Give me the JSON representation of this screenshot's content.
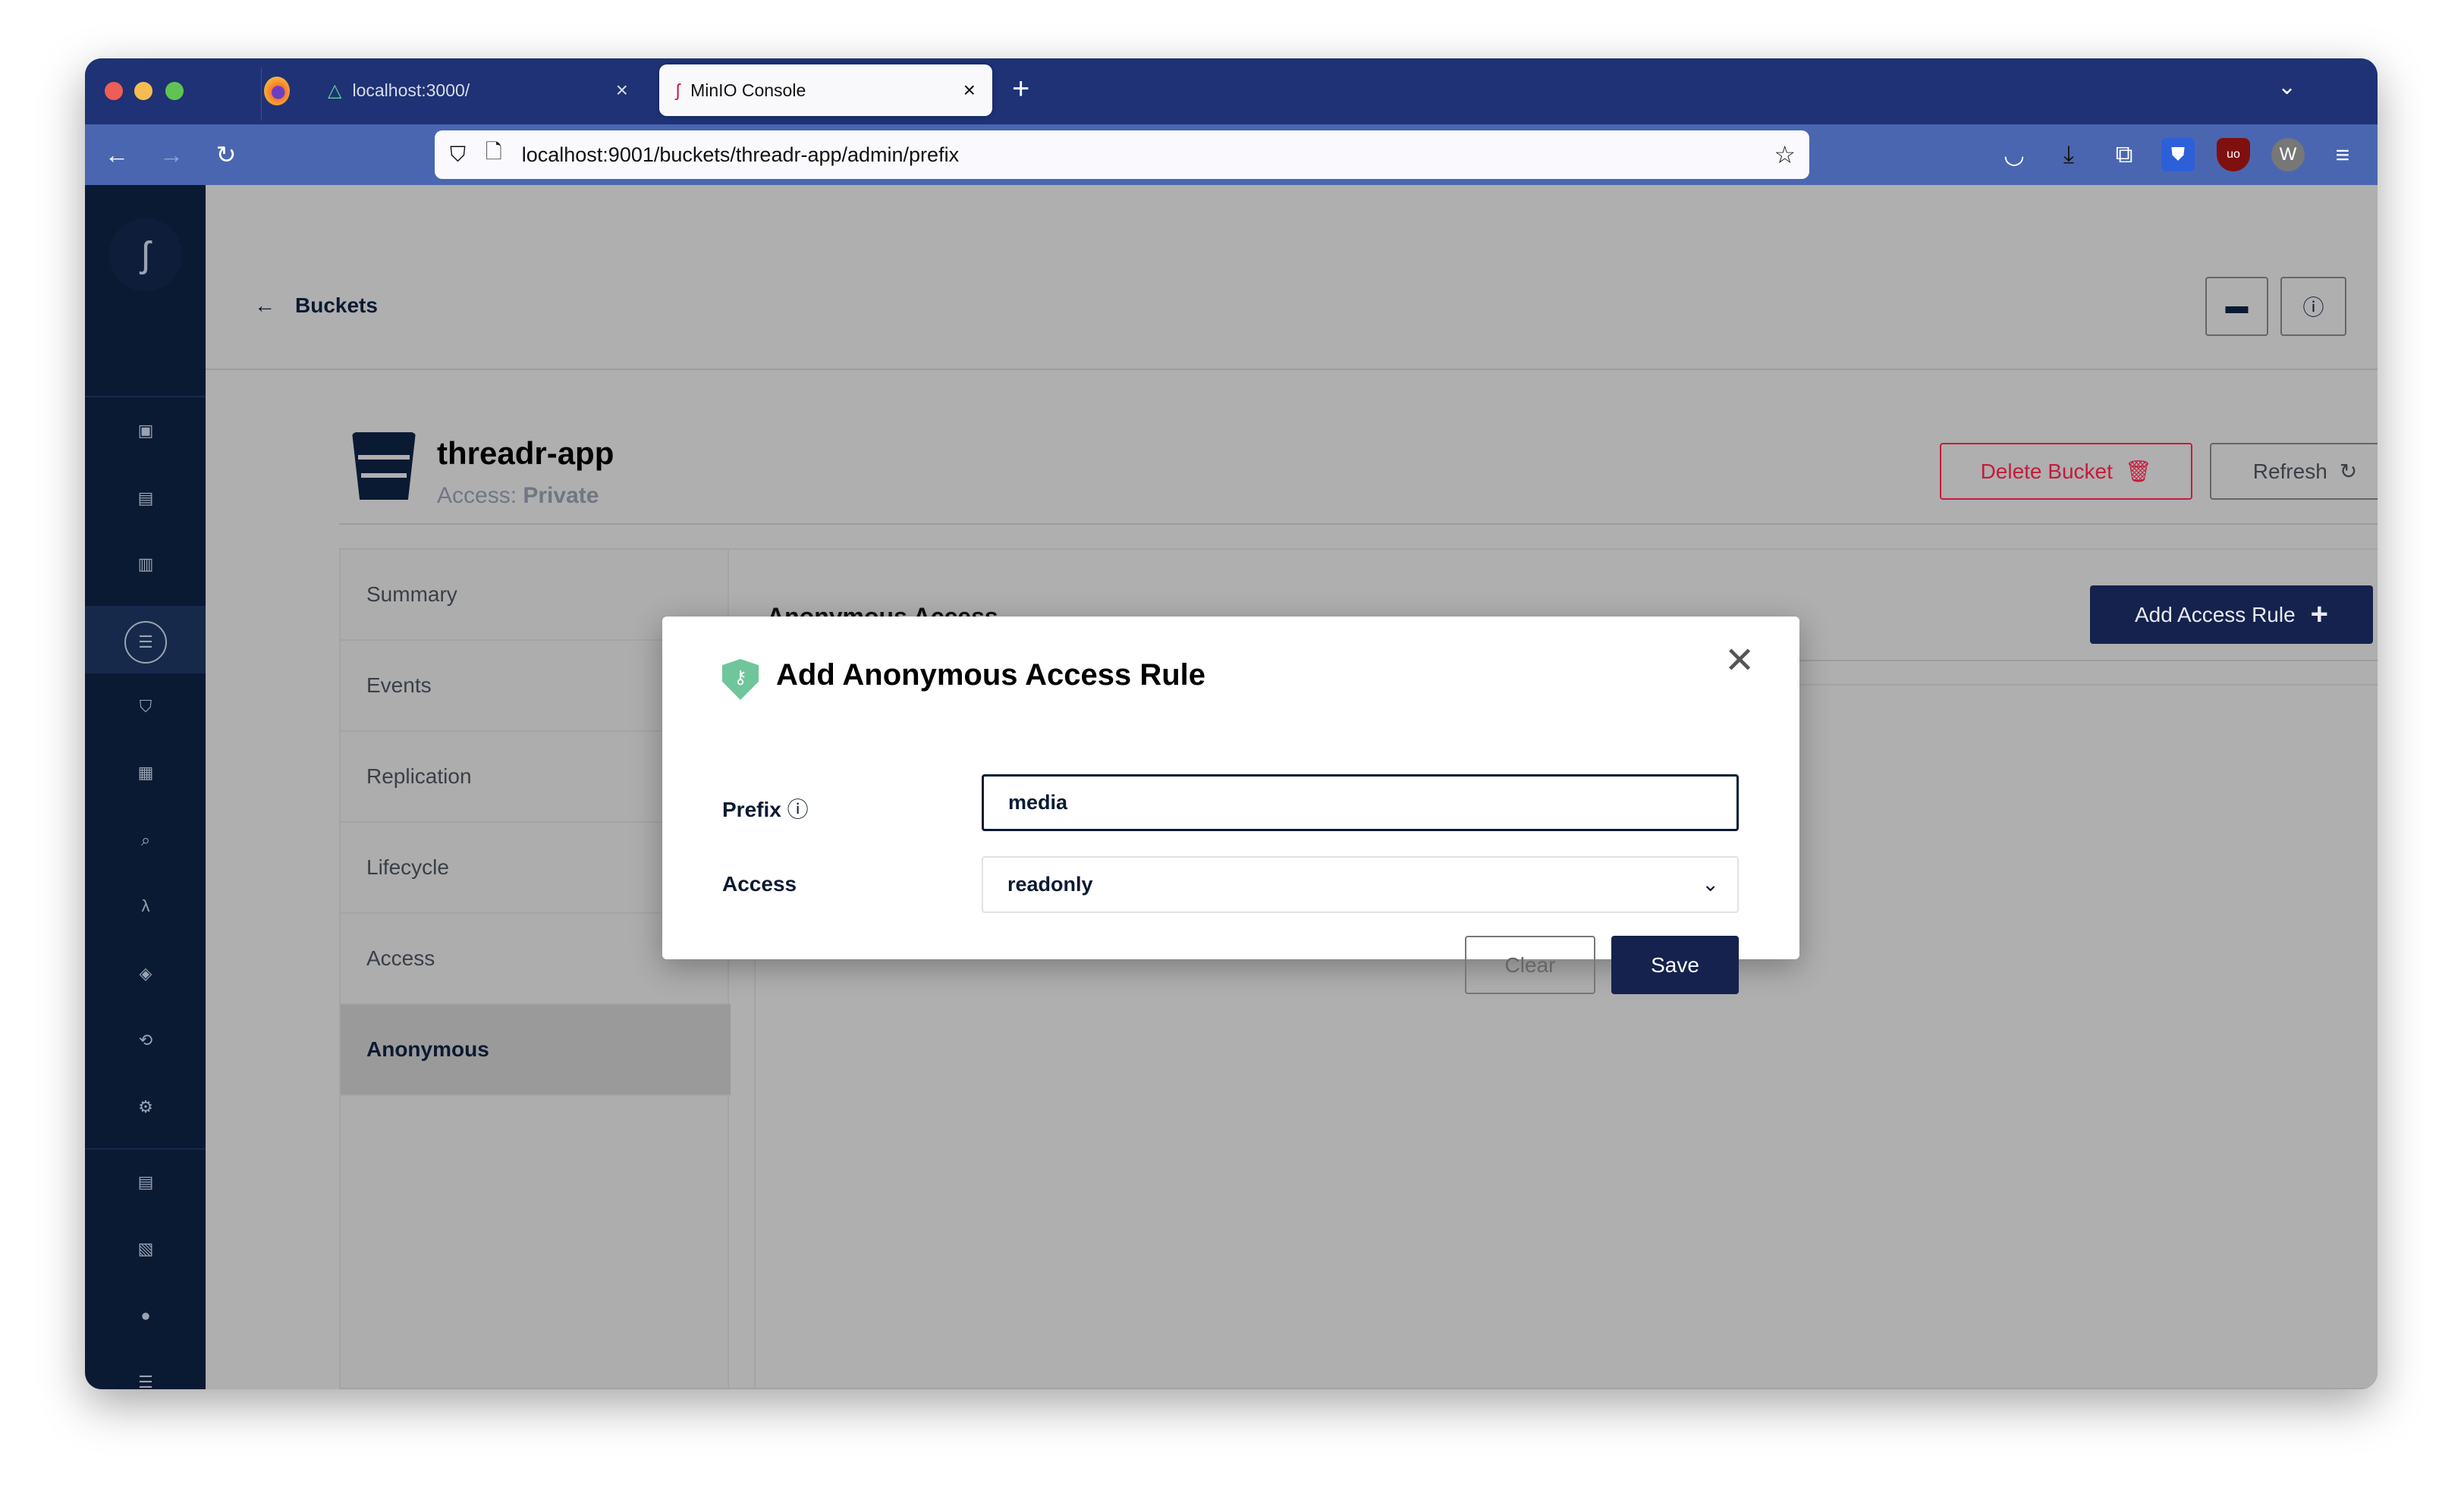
{
  "browser": {
    "tabs": [
      {
        "label": "localhost:3000/",
        "icon": "nuxt-icon"
      },
      {
        "label": "MinIO Console",
        "icon": "minio-icon",
        "active": true
      }
    ],
    "new_tab": "+",
    "url": "localhost:9001/buckets/threadr-app/admin/prefix",
    "toolbar_icons": [
      "pocket-icon",
      "download-icon",
      "extensions-icon",
      "bitwarden-icon",
      "ublock-icon",
      "w-extension-icon",
      "menu-icon"
    ]
  },
  "sidebar": {
    "icons": [
      "objects-icon",
      "identity-icon",
      "policies-icon",
      "buckets-icon",
      "security-icon",
      "monitoring-icon",
      "search-icon",
      "lambda-icon",
      "tiers-icon",
      "replication-icon",
      "settings-icon",
      "notifications-icon",
      "license-icon",
      "support-icon",
      "storage-icon",
      "more-icon"
    ],
    "selected": "buckets-icon"
  },
  "header": {
    "back_label": "Buckets"
  },
  "bucket": {
    "name": "threadr-app",
    "access_label": "Access:",
    "access_value": "Private",
    "delete_label": "Delete Bucket",
    "refresh_label": "Refresh"
  },
  "nav": {
    "items": [
      "Summary",
      "Events",
      "Replication",
      "Lifecycle",
      "Access",
      "Anonymous"
    ],
    "selected": "Anonymous"
  },
  "panel": {
    "title": "Anonymous Access",
    "add_label": "Add Access Rule"
  },
  "modal": {
    "title": "Add Anonymous Access Rule",
    "prefix_label": "Prefix",
    "prefix_value": "media",
    "access_label": "Access",
    "access_value": "readonly",
    "clear_label": "Clear",
    "save_label": "Save"
  },
  "colors": {
    "primary": "#14224d",
    "danger": "#c51b3a",
    "shield": "#6fc69a"
  }
}
